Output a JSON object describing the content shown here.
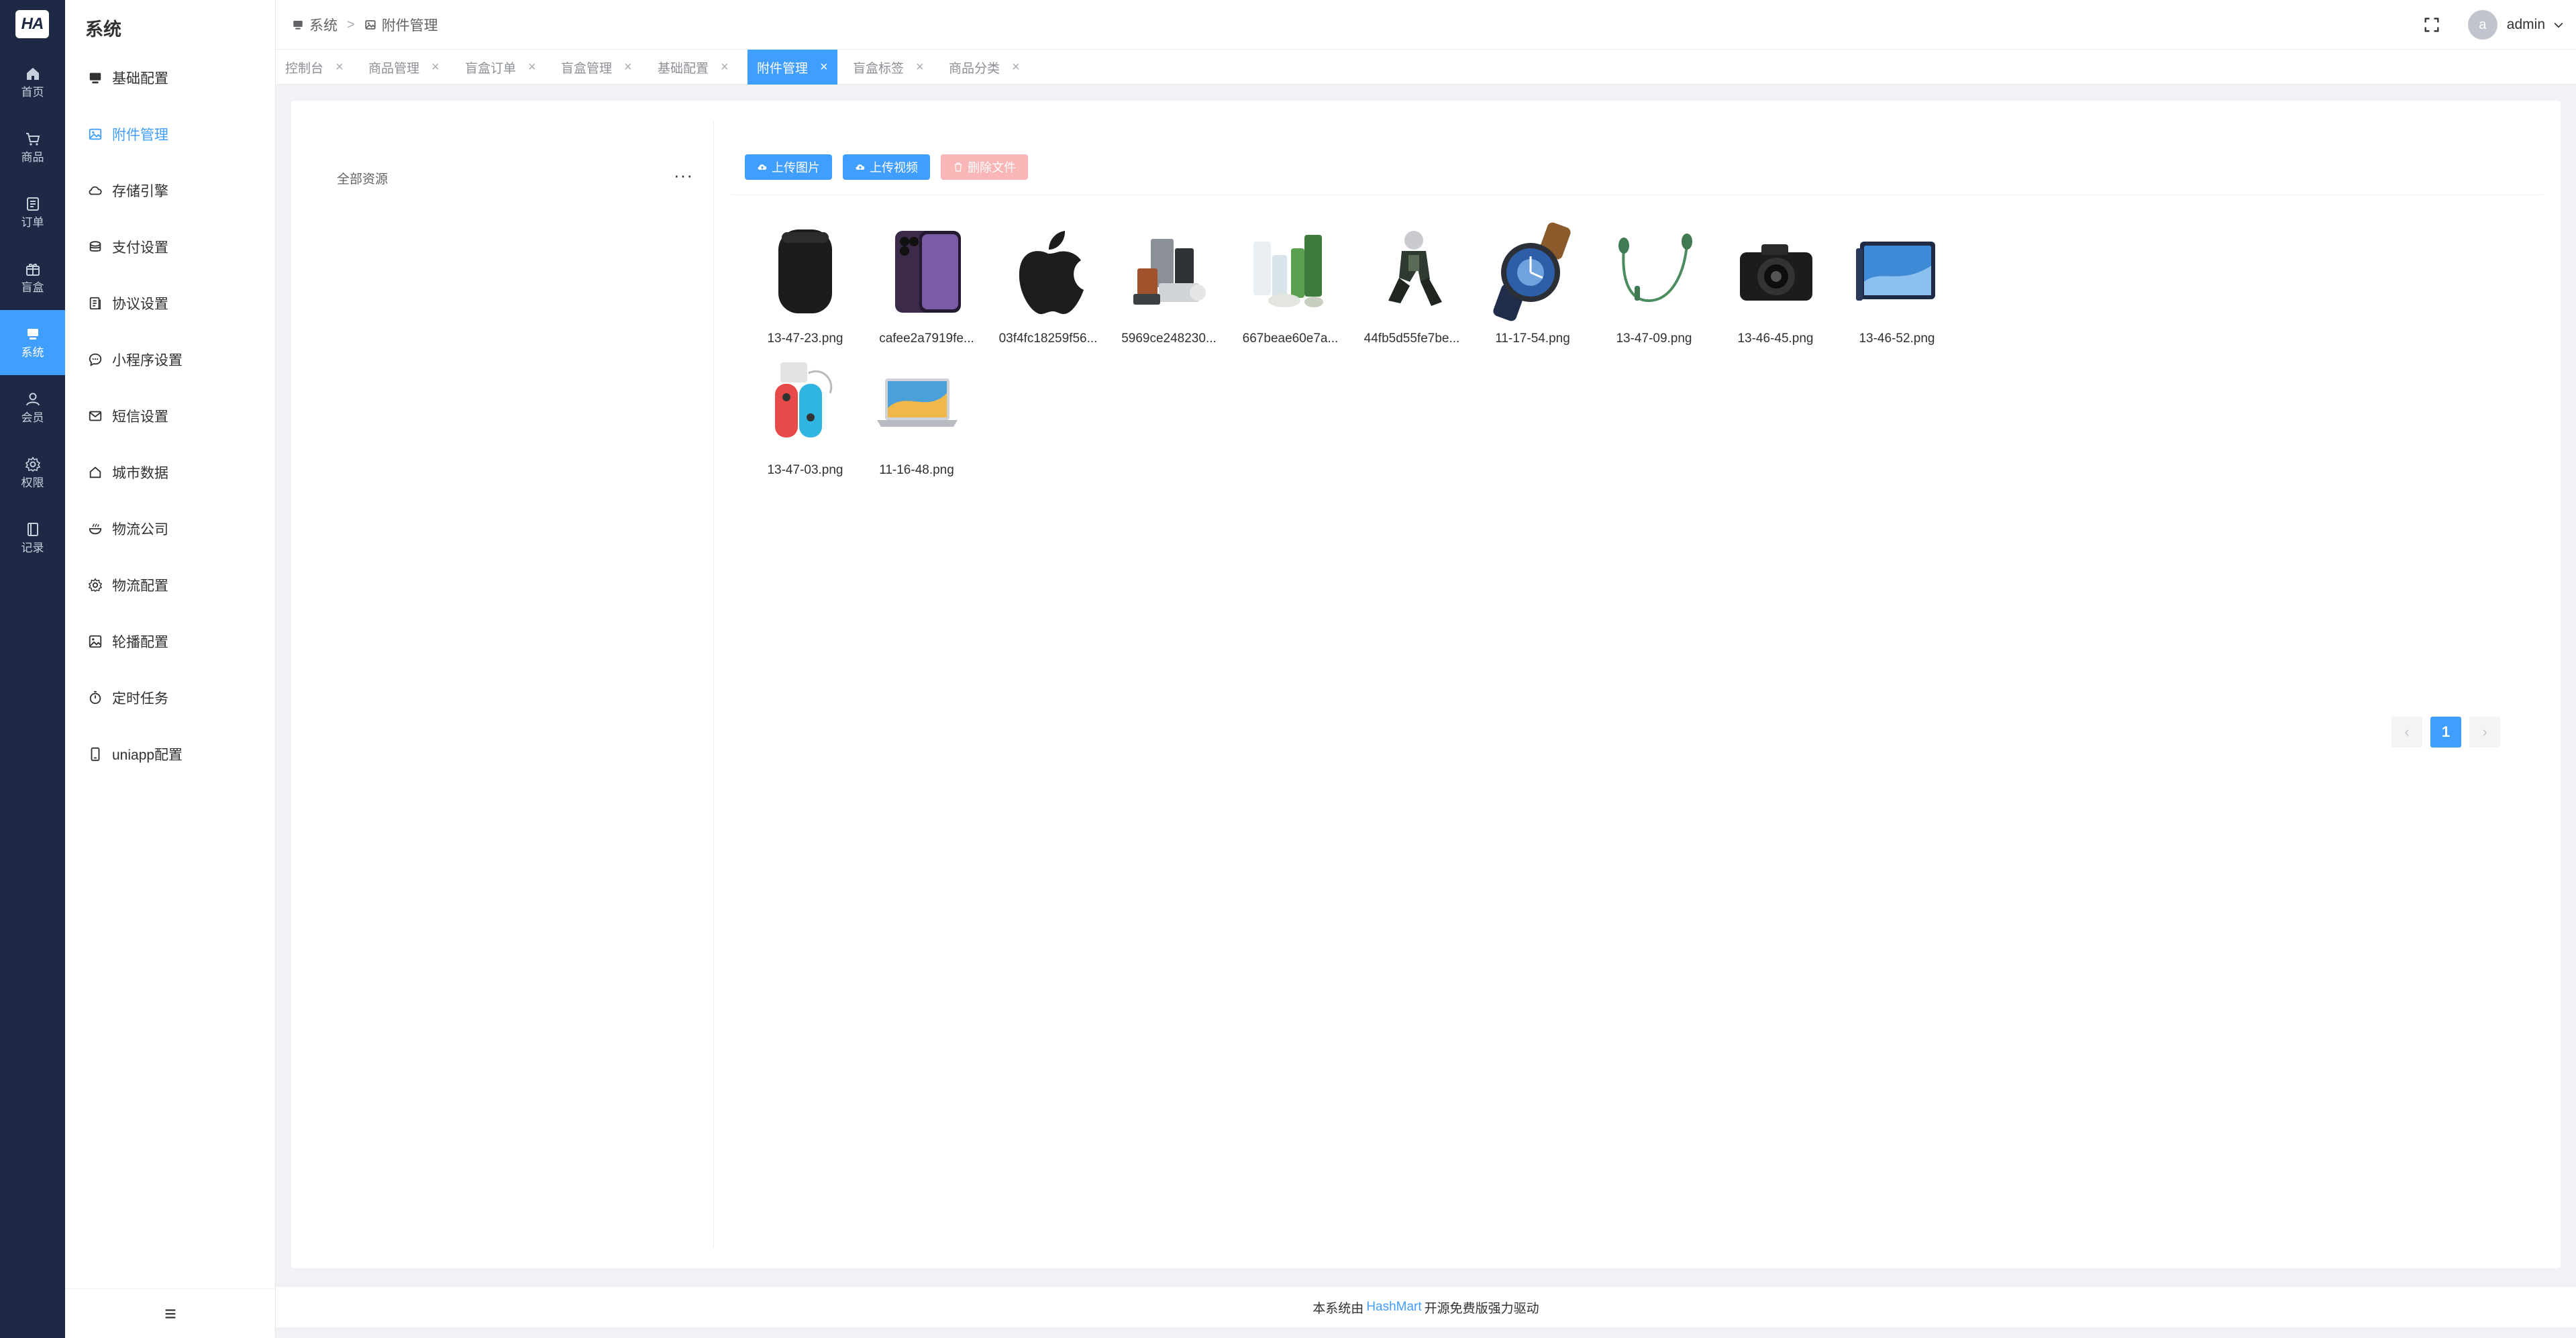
{
  "app": {
    "logo_text": "HA",
    "accent_color": "#409eff",
    "rail_color": "#1e2a45",
    "danger_light": "#fab6b6"
  },
  "rail": {
    "items": [
      {
        "label": "首页",
        "icon": "home-icon"
      },
      {
        "label": "商品",
        "icon": "cart-icon"
      },
      {
        "label": "订单",
        "icon": "order-icon"
      },
      {
        "label": "盲盒",
        "icon": "box-icon"
      },
      {
        "label": "系统",
        "icon": "monitor-icon",
        "active": true
      },
      {
        "label": "会员",
        "icon": "user-icon"
      },
      {
        "label": "权限",
        "icon": "gear-icon"
      },
      {
        "label": "记录",
        "icon": "book-icon"
      }
    ]
  },
  "sidebar": {
    "title": "系统",
    "items": [
      {
        "label": "基础配置",
        "icon": "monitor-icon"
      },
      {
        "label": "附件管理",
        "icon": "image-icon",
        "active": true
      },
      {
        "label": "存储引擎",
        "icon": "cloud-icon"
      },
      {
        "label": "支付设置",
        "icon": "coin-icon"
      },
      {
        "label": "协议设置",
        "icon": "document-icon"
      },
      {
        "label": "小程序设置",
        "icon": "chat-icon"
      },
      {
        "label": "短信设置",
        "icon": "mail-icon"
      },
      {
        "label": "城市数据",
        "icon": "house-icon"
      },
      {
        "label": "物流公司",
        "icon": "bowl-icon"
      },
      {
        "label": "物流配置",
        "icon": "gear-icon"
      },
      {
        "label": "轮播配置",
        "icon": "picture-icon"
      },
      {
        "label": "定时任务",
        "icon": "timer-icon"
      },
      {
        "label": "uniapp配置",
        "icon": "phone-icon"
      }
    ],
    "footer_icon": "hamburger-icon"
  },
  "header": {
    "breadcrumb": [
      {
        "label": "系统",
        "icon": "monitor-icon"
      },
      {
        "label": "附件管理",
        "icon": "image-icon"
      }
    ],
    "fullscreen_icon": "fullscreen-icon",
    "user": {
      "avatar_letter": "a",
      "name": "admin"
    }
  },
  "tabs": [
    {
      "label": "控制台"
    },
    {
      "label": "商品管理"
    },
    {
      "label": "盲盒订单"
    },
    {
      "label": "盲盒管理"
    },
    {
      "label": "基础配置"
    },
    {
      "label": "附件管理",
      "active": true
    },
    {
      "label": "盲盒标签"
    },
    {
      "label": "商品分类"
    }
  ],
  "tab_close_glyph": "×",
  "resources": {
    "tree_root": "全部资源",
    "more_glyph": "···",
    "buttons": {
      "upload_image": "上传图片",
      "upload_video": "上传视频",
      "delete_file": "删除文件"
    },
    "files": [
      {
        "name": "13-47-23.png",
        "thumb": "speaker"
      },
      {
        "name": "cafee2a7919fe...",
        "thumb": "phone"
      },
      {
        "name": "03f4fc18259f56...",
        "thumb": "apple-logo"
      },
      {
        "name": "5969ce248230...",
        "thumb": "electronics-group"
      },
      {
        "name": "667beae60e7a...",
        "thumb": "skincare-bottles"
      },
      {
        "name": "44fb5d55fe7be...",
        "thumb": "figure"
      },
      {
        "name": "11-17-54.png",
        "thumb": "watch"
      },
      {
        "name": "13-47-09.png",
        "thumb": "earphones"
      },
      {
        "name": "13-46-45.png",
        "thumb": "camera"
      },
      {
        "name": "13-46-52.png",
        "thumb": "tablet"
      },
      {
        "name": "13-47-03.png",
        "thumb": "game-controllers"
      },
      {
        "name": "11-16-48.png",
        "thumb": "laptop"
      }
    ],
    "pagination": {
      "prev": "‹",
      "current": "1",
      "next": "›"
    }
  },
  "footer": {
    "prefix": "本系统由",
    "link": "HashMart",
    "suffix": "开源免费版强力驱动"
  }
}
